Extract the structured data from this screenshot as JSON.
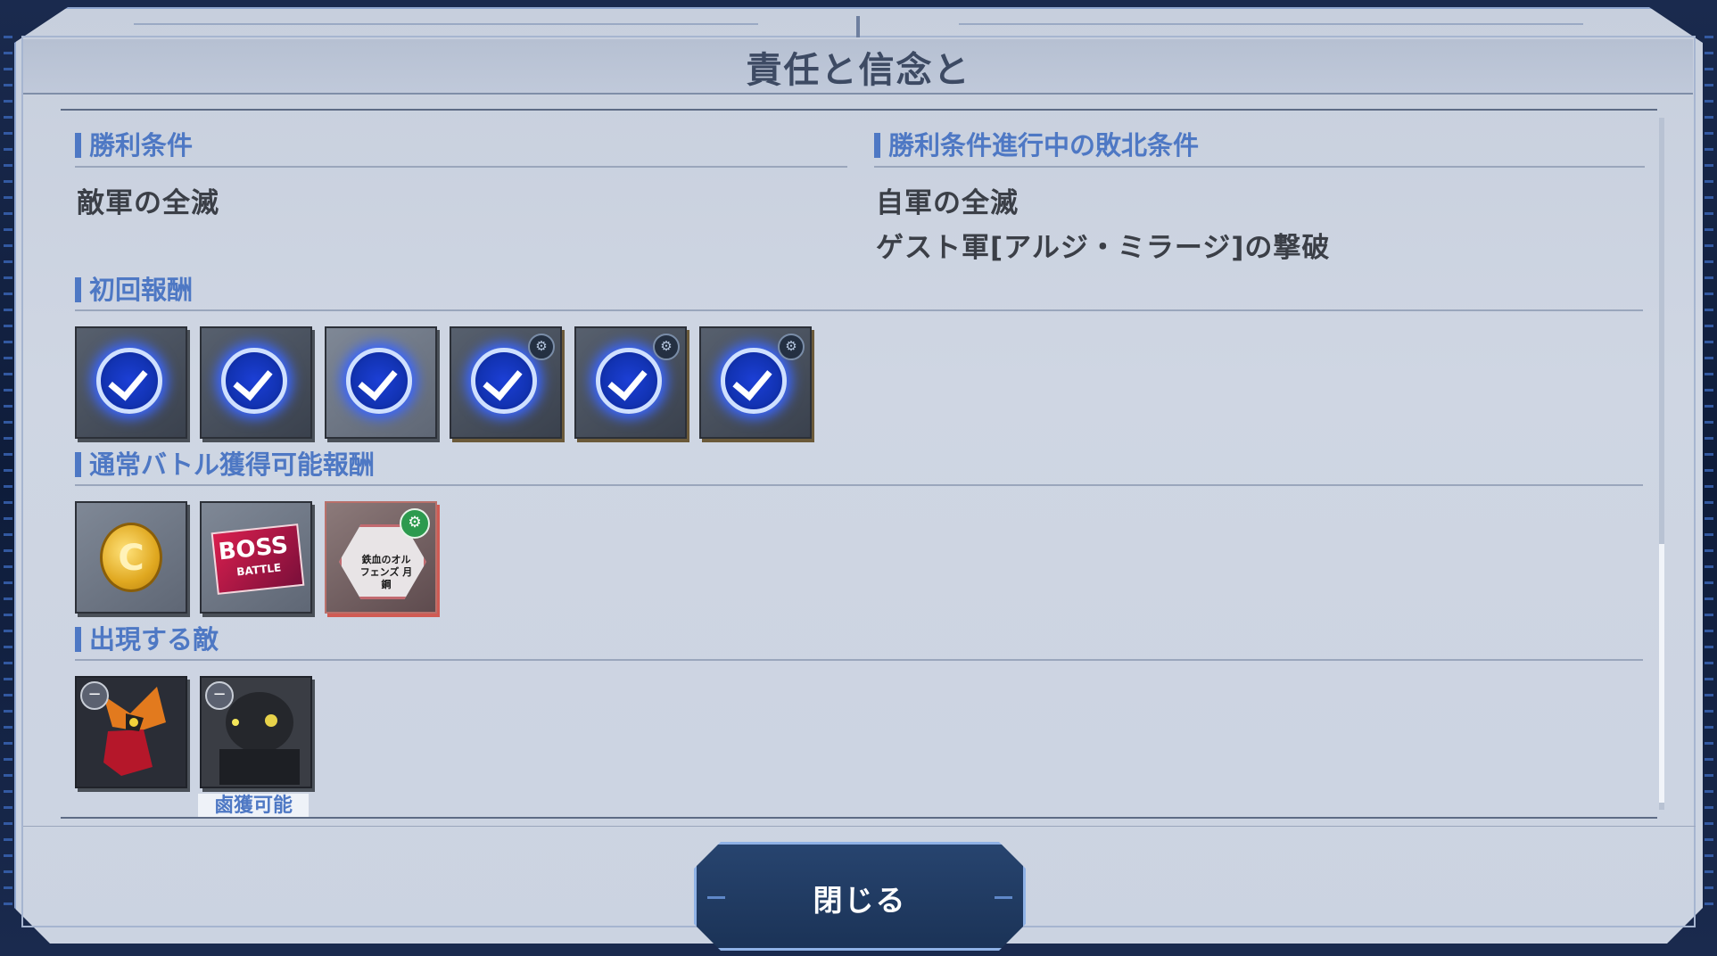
{
  "title": "責任と信念と",
  "victory": {
    "header": "勝利条件",
    "conditions": [
      "敵軍の全滅"
    ]
  },
  "defeat": {
    "header": "勝利条件進行中の敗北条件",
    "conditions": [
      "自軍の全滅",
      "ゲスト軍[アルジ・ミラージ]の撃破"
    ]
  },
  "first_rewards": {
    "header": "初回報酬",
    "items": [
      {
        "icon": "check-icon",
        "wrench": false
      },
      {
        "icon": "check-icon",
        "wrench": false
      },
      {
        "icon": "check-icon",
        "wrench": false
      },
      {
        "icon": "check-icon",
        "wrench": true
      },
      {
        "icon": "check-icon",
        "wrench": true
      },
      {
        "icon": "check-icon",
        "wrench": true
      }
    ]
  },
  "normal_rewards": {
    "header": "通常バトル獲得可能報酬",
    "coin_letter": "C",
    "boss_text": "BOSS",
    "boss_sub": "BATTLE",
    "part_label": "鉄血のオルフェンズ 月鋼"
  },
  "enemies": {
    "header": "出現する敵",
    "capture_label": "鹵獲可能"
  },
  "close_button": "閉じる",
  "colors": {
    "accent": "#4e78c4",
    "panel": "#cbd3e1",
    "button": "#1b3357"
  }
}
